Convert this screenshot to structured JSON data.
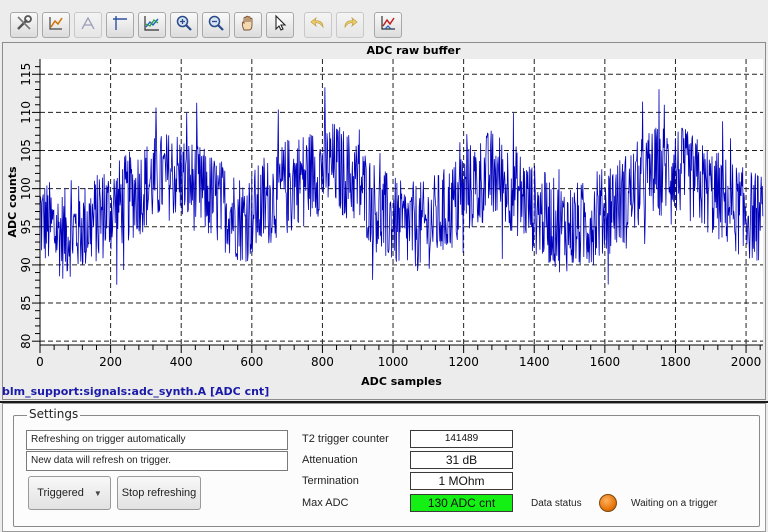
{
  "colors": {
    "signal": "#1a1aa8",
    "trace": "#0000bb",
    "max_adc_bg": "#14f014",
    "led": "#e8780c"
  },
  "toolbar": {
    "buttons": [
      {
        "icon": "configure-icon"
      },
      {
        "icon": "edit-curve-icon"
      },
      {
        "icon": "edit-curve-disabled-icon"
      },
      {
        "icon": "crosshair-icon"
      },
      {
        "icon": "chart-icon"
      },
      {
        "icon": "zoom-in-icon"
      },
      {
        "icon": "zoom-out-icon"
      },
      {
        "icon": "pan-hand-icon"
      },
      {
        "icon": "pointer-icon"
      },
      {
        "icon": "undo-icon",
        "disabled": true
      },
      {
        "icon": "redo-icon",
        "disabled": true
      },
      {
        "icon": "chart-settings-icon"
      }
    ]
  },
  "plot": {
    "title": "ADC raw buffer",
    "signal_label": "blm_support:signals:adc_synth.A [ADC cnt]"
  },
  "chart_data": {
    "type": "line",
    "title": "ADC raw buffer",
    "xlabel": "ADC samples",
    "ylabel": "ADC counts",
    "xlim": [
      0,
      2048
    ],
    "ylim": [
      79.5,
      117
    ],
    "x_ticks": [
      0,
      200,
      400,
      600,
      800,
      1000,
      1200,
      1400,
      1600,
      1800,
      2000
    ],
    "y_ticks": [
      80,
      85,
      90,
      95,
      100,
      105,
      110,
      115
    ],
    "grid": true,
    "series": [
      {
        "x": [
          0,
          64,
          128,
          192,
          256,
          320,
          384,
          448,
          512,
          576,
          640,
          704,
          768,
          832,
          896,
          960,
          1024,
          1088,
          1152,
          1216,
          1280,
          1344,
          1408,
          1472,
          1536,
          1600,
          1664,
          1728,
          1792,
          1856,
          1920,
          1984,
          2048
        ],
        "values": [
          96,
          94,
          95,
          97,
          99,
          101,
          102,
          100,
          98,
          96,
          98,
          101,
          102,
          103,
          101,
          97,
          95,
          95,
          97,
          100,
          102,
          100,
          97,
          95,
          95,
          97,
          99,
          102,
          103,
          101,
          99,
          97,
          96
        ],
        "noise_amplitude": 6
      }
    ]
  },
  "settings": {
    "title": "Settings",
    "status_line_1": "Refreshing on trigger automatically",
    "status_line_2": "New data will refresh on trigger.",
    "mode_button": "Triggered",
    "stop_button": "Stop refreshing",
    "fields": {
      "trigger_counter_label": "T2 trigger counter",
      "trigger_counter_value": "141489",
      "attenuation_label": "Attenuation",
      "attenuation_value": "31 dB",
      "termination_label": "Termination",
      "termination_value": "1 MOhm",
      "max_adc_label": "Max ADC",
      "max_adc_value": "130 ADC cnt"
    },
    "data_status_label": "Data status",
    "waiting_label": "Waiting on a trigger"
  }
}
